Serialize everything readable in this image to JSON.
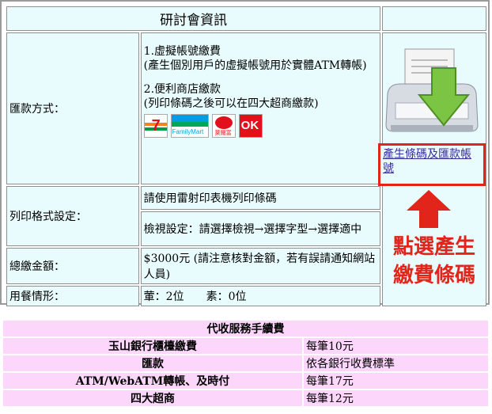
{
  "info": {
    "title": "研討會資訊",
    "payment_label": "匯款方式：",
    "payment_option1_title": "1.虛擬帳號繳費",
    "payment_option1_desc": "(產生個別用戶的虛擬帳號用於實體ATM轉帳)",
    "payment_option2_title": "2.便利商店繳款",
    "payment_option2_desc": "(列印條碼之後可以在四大超商繳款)",
    "stores": [
      "7-ELEVEN",
      "FamilyMart",
      "萊爾富",
      "OK"
    ],
    "print_label": "列印格式設定：",
    "print_line1": "請使用雷射印表機列印條碼",
    "print_line2": "檢視設定：請選擇檢視→選擇字型→選擇適中",
    "total_label": "總繳金額：",
    "total_value": "$3000元 (請注意核對金額，若有誤請通知網站人員)",
    "meal_label": "用餐情形：",
    "meal_value": "葷：2位　　素：0位"
  },
  "side": {
    "link_text": "產生條碼及匯款帳號",
    "hint_text": "點選產生繳費條碼"
  },
  "fees": {
    "header": "代收服務手續費",
    "rows": [
      {
        "name": "玉山銀行櫃檯繳費",
        "fee": "每筆10元"
      },
      {
        "name": "匯款",
        "fee": "依各銀行收費標準"
      },
      {
        "name": "ATM/WebATM轉帳、及時付",
        "fee": "每筆17元"
      },
      {
        "name": "四大超商",
        "fee": "每筆12元"
      }
    ]
  },
  "colors": {
    "cell_bg": "#e8fbfd",
    "fee_bg": "#fdd7fb",
    "highlight_red": "#e1251b",
    "link": "#3b2a99"
  }
}
